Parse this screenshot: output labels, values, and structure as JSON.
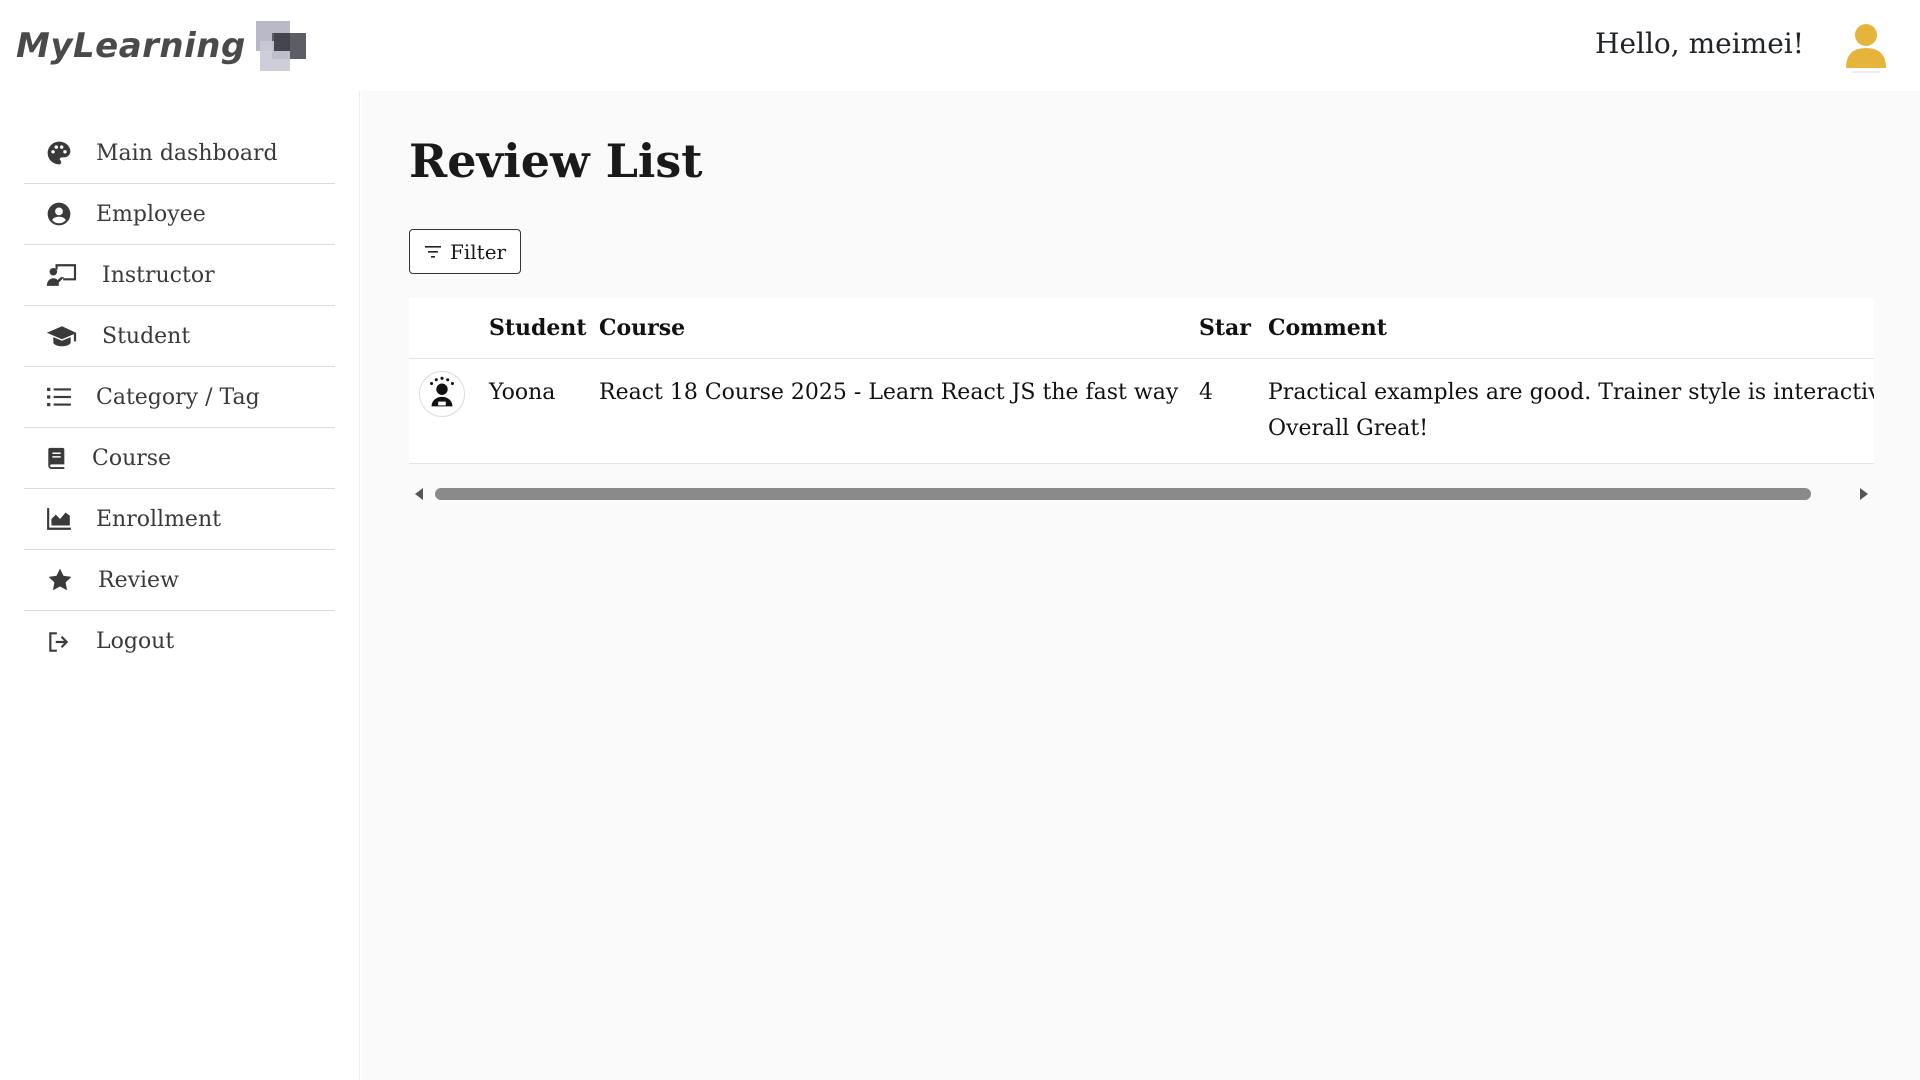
{
  "header": {
    "logo_text": "MyLearning",
    "greeting": "Hello, meimei!",
    "accent_color": "#e6b43a"
  },
  "sidebar": {
    "items": [
      {
        "label": "Main dashboard",
        "icon": "palette-icon"
      },
      {
        "label": "Employee",
        "icon": "user-circle-icon"
      },
      {
        "label": "Instructor",
        "icon": "chalkboard-teacher-icon"
      },
      {
        "label": "Student",
        "icon": "graduation-cap-icon"
      },
      {
        "label": "Category / Tag",
        "icon": "list-icon"
      },
      {
        "label": "Course",
        "icon": "book-icon"
      },
      {
        "label": "Enrollment",
        "icon": "area-chart-icon"
      },
      {
        "label": "Review",
        "icon": "star-icon"
      },
      {
        "label": "Logout",
        "icon": "sign-out-icon"
      }
    ]
  },
  "main": {
    "title": "Review List",
    "filter_label": "Filter",
    "table": {
      "headers": [
        "",
        "Student",
        "Course",
        "Star",
        "Comment"
      ],
      "rows": [
        {
          "student": "Yoona",
          "course": "React 18 Course 2025 - Learn React JS the fast way",
          "star": "4",
          "comment": "Practical examples are good. Trainer style is interactive, lucid and clear. Overall Great!"
        }
      ]
    }
  }
}
